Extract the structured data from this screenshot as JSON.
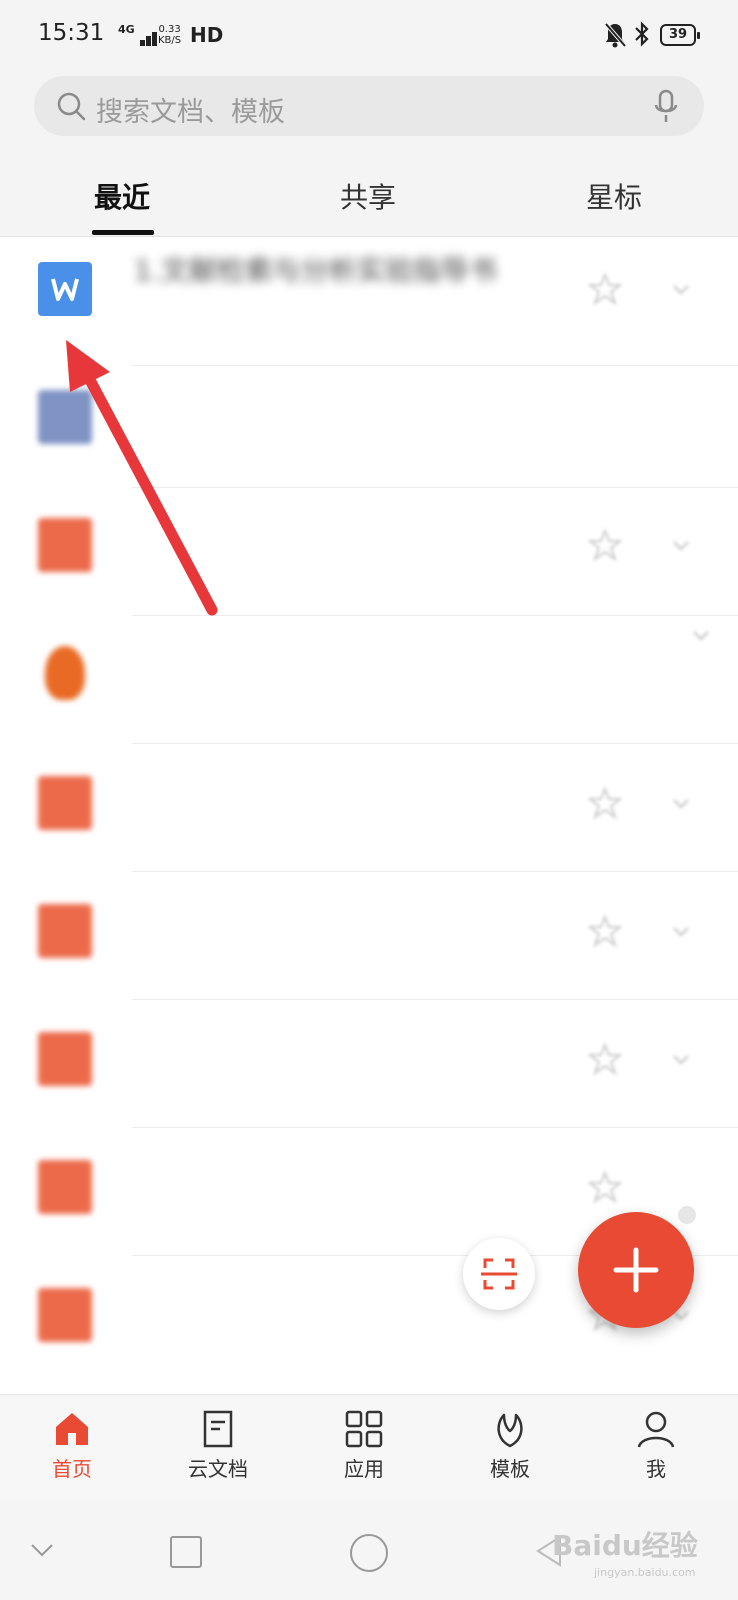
{
  "status_bar": {
    "time": "15:31",
    "network": "4G",
    "speed_value": "0.33",
    "speed_unit": "KB/S",
    "hd": "HD",
    "battery": "39"
  },
  "search": {
    "placeholder": "搜索文档、模板"
  },
  "tabs": [
    {
      "label": "最近",
      "active": true
    },
    {
      "label": "共享",
      "active": false
    },
    {
      "label": "星标",
      "active": false
    }
  ],
  "files": [
    {
      "icon": "word-doc-icon",
      "title": "1.文献检索与分析实验指导书"
    },
    {
      "icon": "mail-doc-icon",
      "title": "",
      "subtitle": ""
    },
    {
      "icon": "pdf-doc-icon",
      "title": ""
    },
    {
      "icon": "avatar-icon",
      "title": "",
      "subtitle": ""
    },
    {
      "icon": "pdf-doc-icon",
      "title": ""
    },
    {
      "icon": "pdf-doc-icon",
      "title": ""
    },
    {
      "icon": "pdf-doc-icon",
      "title": ""
    },
    {
      "icon": "pdf-doc-icon",
      "title": ""
    },
    {
      "icon": "pdf-doc-icon",
      "title": ""
    }
  ],
  "bottom_nav": [
    {
      "label": "首页",
      "icon": "home-icon",
      "active": true
    },
    {
      "label": "云文档",
      "icon": "cloud-doc-icon",
      "active": false
    },
    {
      "label": "应用",
      "icon": "apps-grid-icon",
      "active": false
    },
    {
      "label": "模板",
      "icon": "template-leaf-icon",
      "active": false
    },
    {
      "label": "我",
      "icon": "profile-icon",
      "active": false
    }
  ],
  "watermark": {
    "text": "Baidu经验",
    "sub": "jingyan.baidu.com"
  },
  "colors": {
    "accent": "#e94a33",
    "word_blue": "#4a8fe8",
    "annotation_arrow": "#e8373a"
  }
}
